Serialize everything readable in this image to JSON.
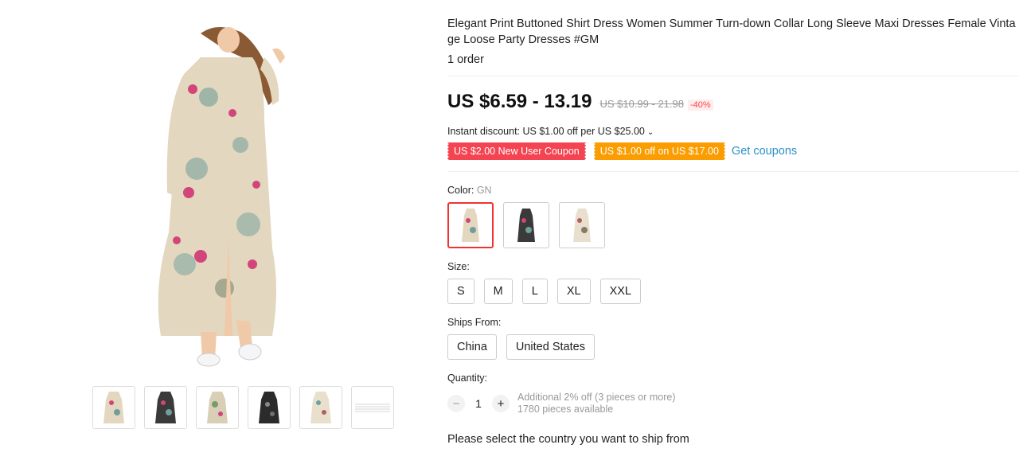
{
  "product": {
    "title": "Elegant Print Buttoned Shirt Dress Women Summer Turn-down Collar Long Sleeve Maxi Dresses Female Vintage Loose Party Dresses #GM",
    "orders": "1 order"
  },
  "price": {
    "current": "US $6.59 - 13.19",
    "original": "US $10.99 - 21.98",
    "discount": "-40%"
  },
  "instant_discount": "Instant discount: US $1.00 off per US $25.00",
  "coupons": {
    "new_user": "US $2.00 New User Coupon",
    "store": "US $1.00 off on US $17.00",
    "get_label": "Get coupons"
  },
  "color": {
    "label": "Color:",
    "selected": "GN"
  },
  "size": {
    "label": "Size:",
    "options": [
      "S",
      "M",
      "L",
      "XL",
      "XXL"
    ]
  },
  "ships_from": {
    "label": "Ships From:",
    "options": [
      "China",
      "United States"
    ]
  },
  "quantity": {
    "label": "Quantity:",
    "value": "1",
    "minus": "−",
    "plus": "+",
    "note1": "Additional 2% off (3 pieces or more)",
    "note2": "1780 pieces available"
  },
  "ship_message": "Please select the country you want to ship from",
  "colors": {
    "beige": "#e3d7bf",
    "dark": "#3a3a3a",
    "pink": "#d2457a",
    "teal": "#6f9f9a",
    "accent_red": "#f44452",
    "accent_orange": "#fb9d00",
    "link": "#2c90c9"
  }
}
